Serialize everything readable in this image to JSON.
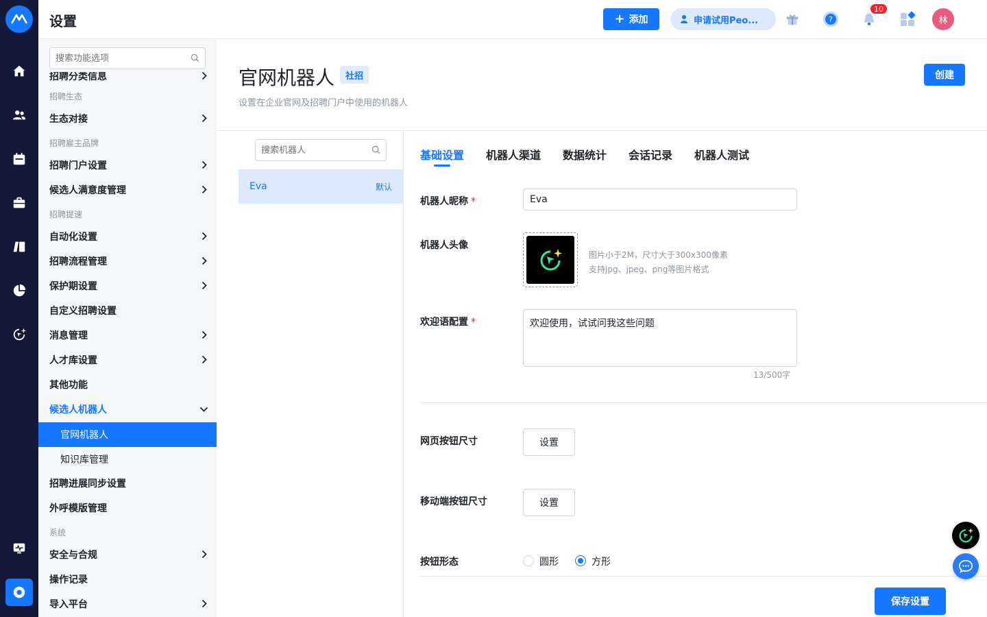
{
  "header": {
    "title": "设置",
    "add_label": "添加",
    "trial_label": "申请试用Peo...",
    "notification_count": "10",
    "user_initial": "林"
  },
  "sidebar": {
    "search_placeholder": "搜索功能选项",
    "clipped_item": "招聘分类信息",
    "groups": {
      "ecosystem": "招聘生态",
      "brand": "招聘雇主品牌",
      "speed": "招聘提速",
      "system": "系统"
    },
    "items": {
      "eco_connect": "生态对接",
      "portal": "招聘门户设置",
      "satisfaction": "候选人满意度管理",
      "automation": "自动化设置",
      "process": "招聘流程管理",
      "protection": "保护期设置",
      "custom": "自定义招聘设置",
      "message": "消息管理",
      "talent": "人才库设置",
      "other": "其他功能",
      "candidate_bot": "候选人机器人",
      "website_bot": "官网机器人",
      "knowledge": "知识库管理",
      "sync": "招聘进展同步设置",
      "outbound": "外呼模版管理",
      "security": "安全与合规",
      "oplog": "操作记录",
      "import": "导入平台"
    }
  },
  "main": {
    "title": "官网机器人",
    "tag": "社招",
    "description": "设置在企业官网及招聘门户中使用的机器人",
    "create_label": "创建",
    "bot_search_placeholder": "搜索机器人",
    "bots": [
      {
        "name": "Eva",
        "badge": "默认"
      }
    ],
    "tabs": [
      "基础设置",
      "机器人渠道",
      "数据统计",
      "会话记录",
      "机器人测试"
    ],
    "form": {
      "nickname_label": "机器人昵称",
      "nickname_value": "Eva",
      "avatar_label": "机器人头像",
      "avatar_hint_1": "图片小于2M，尺寸大于300x300像素",
      "avatar_hint_2": "支持jpg、jpeg、png等图片格式",
      "welcome_label": "欢迎语配置",
      "welcome_value": "欢迎使用，试试问我这些问题",
      "welcome_counter": "13/500字",
      "web_size_label": "网页按钮尺寸",
      "mobile_size_label": "移动端按钮尺寸",
      "set_label": "设置",
      "shape_label": "按钮形态",
      "shape_circle": "圆形",
      "shape_square": "方形",
      "shape_selected": "方形",
      "required_mark": "*"
    },
    "save_label": "保存设置"
  },
  "colors": {
    "primary": "#1677ff",
    "rail": "#14193a",
    "accent_green": "#2ee6a6"
  }
}
